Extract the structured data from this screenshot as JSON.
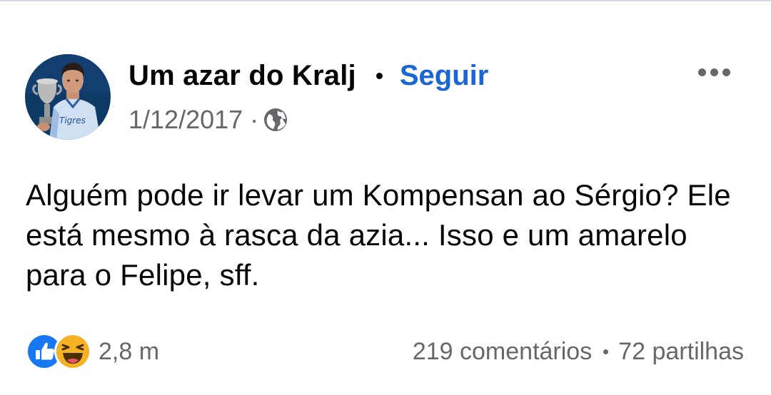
{
  "post": {
    "author": "Um azar do Kralj",
    "follow_label": "Seguir",
    "date": "1/12/2017",
    "meta_separator": "·",
    "privacy_icon": "globe-icon",
    "more_icon": "more-options-icon",
    "text": "Alguém pode ir levar um Kompensan ao Sérgio? Ele está mesmo à rasca da azia... Isso e um amarelo para o Felipe, sff."
  },
  "reactions": {
    "icons": [
      "like-icon",
      "haha-icon"
    ],
    "count": "2,8 m"
  },
  "engagement": {
    "comments": "219 comentários",
    "shares": "72 partilhas"
  },
  "colors": {
    "follow": "#1b66d2",
    "text": "#050505",
    "secondary": "#65676b",
    "like": "#1877f2",
    "haha": "#f7b125"
  }
}
